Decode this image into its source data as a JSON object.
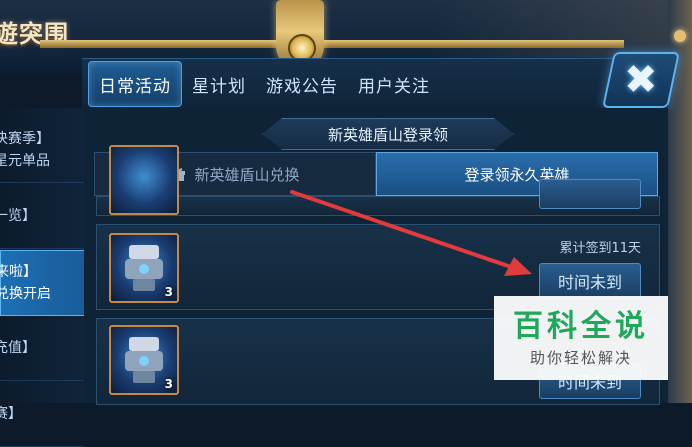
{
  "header": {
    "title_fragment": "遊突围"
  },
  "tabs": [
    {
      "label": "日常活动",
      "active": true
    },
    {
      "label": "星计划",
      "active": false
    },
    {
      "label": "游戏公告",
      "active": false
    },
    {
      "label": "用户关注",
      "active": false
    }
  ],
  "close_icon": "close-x-icon",
  "sidebar": {
    "items": [
      {
        "line1": "决赛季】",
        "line2": "星元单品",
        "active": false
      },
      {
        "line1": "一览】",
        "line2": "",
        "active": false
      },
      {
        "line1": "来啦】",
        "line2": "兑换开启",
        "active": true
      },
      {
        "line1": "充值】",
        "line2": "",
        "active": false
      },
      {
        "line1": "赛】",
        "line2": "",
        "active": false
      }
    ]
  },
  "panel": {
    "subtitle": "新英雄盾山登录领",
    "subtabs": [
      {
        "label": "新英雄盾山兑换",
        "icon": "gift-icon",
        "active": false
      },
      {
        "label": "登录领永久英雄",
        "active": true
      }
    ],
    "rows": [
      {
        "status": "累计签到11天",
        "button": "时间未到",
        "count": "3"
      },
      {
        "status": "",
        "button": "时间未到",
        "count": "3"
      }
    ]
  },
  "annotation": {
    "arrow_color": "#e23b3b"
  },
  "watermark": {
    "main": "百科全说",
    "sub": "助你轻松解决"
  },
  "colors": {
    "accent_blue": "#1c6fb5",
    "gold": "#e2c47a",
    "watermark_green": "#1ea95a"
  }
}
